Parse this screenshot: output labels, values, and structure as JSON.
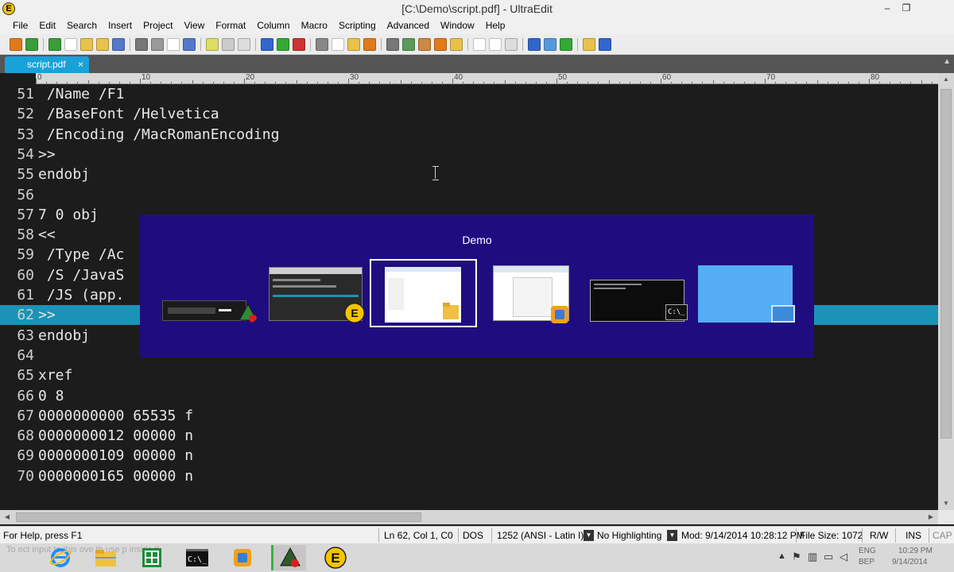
{
  "window": {
    "title": "[C:\\Demo\\script.pdf] - UltraEdit",
    "app_logo_letter": "E",
    "minimize_glyph": "–",
    "restore_glyph": "❐"
  },
  "menu": [
    "File",
    "Edit",
    "Search",
    "Insert",
    "Project",
    "View",
    "Format",
    "Column",
    "Macro",
    "Scripting",
    "Advanced",
    "Window",
    "Help"
  ],
  "toolbar": {
    "icons": [
      "new-file-icon",
      "back-arrow-icon",
      "forward-arrow-icon",
      "new-document-icon",
      "open-folder-icon",
      "open-file-icon",
      "save-icon",
      "print-icon",
      "print-preview-icon",
      "spell-check-icon",
      "find-icon",
      "column-mode-icon",
      "word-wrap-icon",
      "toggle-view-icon",
      "back-nav-icon",
      "forward-nav-icon",
      "stop-icon",
      "cut-icon",
      "copy-icon",
      "paste-icon",
      "clipboard-icon",
      "compare-icon",
      "sort-icon",
      "macro-icon",
      "ftp-icon",
      "ftp-upload-icon",
      "window-tile-icon",
      "window-cascade-icon",
      "window-list-icon",
      "browser-icon",
      "email-icon",
      "refresh-icon",
      "tips-icon",
      "help-icon"
    ],
    "colors": [
      "#e07b1a",
      "#3a9c3a",
      "#3a9c3a",
      "#ffffff",
      "#e8c24a",
      "#e8c24a",
      "#5577cc",
      "#777777",
      "#999999",
      "#ffffff",
      "#5577cc",
      "#dddd66",
      "#cccccc",
      "#dddddd",
      "#3366cc",
      "#33aa33",
      "#cc3333",
      "#888888",
      "#ffffff",
      "#e8c24a",
      "#e07b1a",
      "#777777",
      "#5a9a5a",
      "#cc8844",
      "#e07b1a",
      "#e8c24a",
      "#ffffff",
      "#ffffff",
      "#dddddd",
      "#3366cc",
      "#5599dd",
      "#33aa33",
      "#e8c24a",
      "#3366cc"
    ]
  },
  "tabs": [
    {
      "label": "script.pdf",
      "close": "×"
    }
  ],
  "ruler": {
    "labels": [
      "0",
      "10",
      "20",
      "30",
      "40",
      "50",
      "60",
      "70",
      "80"
    ]
  },
  "editor": {
    "current_line": 62,
    "lines": [
      {
        "n": "51",
        "text": " /Name /F1"
      },
      {
        "n": "52",
        "text": " /BaseFont /Helvetica"
      },
      {
        "n": "53",
        "text": " /Encoding /MacRomanEncoding"
      },
      {
        "n": "54",
        "text": ">>"
      },
      {
        "n": "55",
        "text": "endobj"
      },
      {
        "n": "56",
        "text": ""
      },
      {
        "n": "57",
        "text": "7 0 obj"
      },
      {
        "n": "58",
        "text": "<<"
      },
      {
        "n": "59",
        "text": " /Type /Ac"
      },
      {
        "n": "60",
        "text": " /S /JavaS"
      },
      {
        "n": "61",
        "text": " /JS (app.                                     avaScript', "
      },
      {
        "n": "62",
        "text": ">>"
      },
      {
        "n": "63",
        "text": "endobj"
      },
      {
        "n": "64",
        "text": ""
      },
      {
        "n": "65",
        "text": "xref"
      },
      {
        "n": "66",
        "text": "0 8"
      },
      {
        "n": "67",
        "text": "0000000000 65535 f"
      },
      {
        "n": "68",
        "text": "0000000012 00000 n"
      },
      {
        "n": "69",
        "text": "0000000109 00000 n"
      },
      {
        "n": "70",
        "text": "0000000165 00000 n"
      }
    ]
  },
  "switcher": {
    "title": "Demo",
    "thumbnails": [
      {
        "name": "switcher-thumb-media-app",
        "icon": "media-app-icon",
        "icon_color": "#2d8a3a"
      },
      {
        "name": "switcher-thumb-ultraedit",
        "icon": "ultraedit-icon",
        "icon_color": "#f5c400"
      },
      {
        "name": "switcher-thumb-file-explorer",
        "icon": "folder-icon",
        "icon_color": "#f0c040"
      },
      {
        "name": "switcher-thumb-virtual-machine",
        "icon": "virtual-machine-icon",
        "icon_color": "#f0a020"
      },
      {
        "name": "switcher-thumb-command-prompt",
        "icon": "command-prompt-icon",
        "icon_color": "#111111"
      },
      {
        "name": "switcher-thumb-desktop",
        "icon": "desktop-icon",
        "icon_color": "#5a9de0"
      }
    ],
    "cmd_icon_text": "C:\\_"
  },
  "status": {
    "help": "For Help, press F1",
    "position": "Ln 62, Col 1, C0",
    "line_ending": "DOS",
    "encoding": "1252  (ANSI - Latin I)",
    "highlighting": "No Highlighting",
    "modified": "Mod: 9/14/2014 10:28:12 PM",
    "file_size": "File Size: 1072",
    "rw": "R/W",
    "ins": "INS",
    "caps": "CAP"
  },
  "taskbar": {
    "ghost_text": "To  ect input to this    ove th    use p   inside    tl",
    "apps": [
      "ie-icon",
      "file-explorer-icon",
      "excel-icon",
      "command-prompt-icon",
      "virtual-machine-icon",
      "media-app-icon",
      "ultraedit-icon"
    ],
    "cmd_text": "C:\\_",
    "language": "ENG",
    "region": "BEP",
    "time": "10:29 PM",
    "date": "9/14/2014"
  }
}
